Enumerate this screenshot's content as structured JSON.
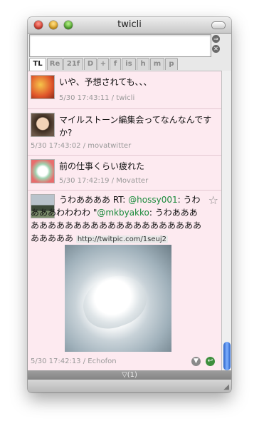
{
  "window": {
    "title": "twicli",
    "scroll_arrow_up": "▲",
    "scroll_arrow_down": "▼"
  },
  "side_buttons": {
    "post": "⇒",
    "clear": "✕"
  },
  "tabs": [
    {
      "label": "TL",
      "active": true
    },
    {
      "label": "Re",
      "active": false
    },
    {
      "label": "21f",
      "active": false
    },
    {
      "label": "D",
      "active": false
    },
    {
      "label": "+",
      "active": false
    },
    {
      "label": "f",
      "active": false
    },
    {
      "label": "is",
      "active": false
    },
    {
      "label": "h",
      "active": false
    },
    {
      "label": "m",
      "active": false
    },
    {
      "label": "p",
      "active": false
    }
  ],
  "tweets": [
    {
      "text": "いや、予想されても、、、",
      "time": "5/30 17:43:11",
      "source": "twicli"
    },
    {
      "text": "マイルストーン編集会ってなんなんですか?",
      "time": "5/30 17:43:02",
      "source": "movatwitter"
    },
    {
      "text": "前の仕事くらい疲れた",
      "time": "5/30 17:42:19",
      "source": "Movatter"
    },
    {
      "text_parts": {
        "prefix": "うわああああ RT: ",
        "mention1": "@hossy001",
        "middle": ": うわあああわわわわ \"",
        "mention2": "@mkbyakko",
        "suffix": ": うわああああああああああああああああああああああああああああ ",
        "link": "http://twitpic.com/1seuj2"
      },
      "time": "5/30 17:42:13",
      "source": "Echofon",
      "star": "☆",
      "btn_down": "▼",
      "btn_reply": "↩"
    }
  ],
  "status": {
    "text": "▽(1)"
  },
  "colors": {
    "timeline_bg": "#fdeaf0",
    "mention": "#1a8a3b",
    "scroll_thumb": "#2b63c8"
  }
}
